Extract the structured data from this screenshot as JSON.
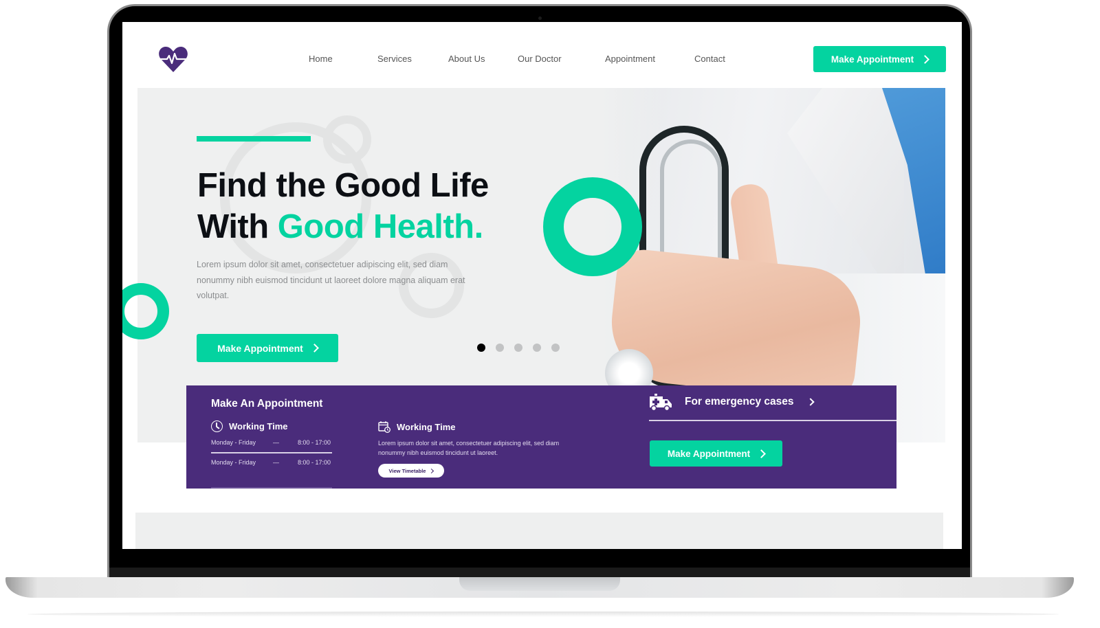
{
  "header": {
    "logo_icon": "heart-pulse-icon",
    "nav": [
      "Home",
      "Services",
      "About Us",
      "Our Doctor",
      "Appointment",
      "Contact"
    ],
    "cta_label": "Make Appointment"
  },
  "hero": {
    "title_line1": "Find the Good Life",
    "title_line2_prefix": "With ",
    "title_line2_highlight": "Good Health.",
    "description": "Lorem ipsum dolor sit amet, consectetuer adipiscing elit, sed diam nonummy nibh euismod tincidunt ut laoreet dolore magna aliquam erat volutpat.",
    "cta_label": "Make Appointment",
    "slides_total": 5,
    "slide_active": 1
  },
  "appointment_panel": {
    "title": "Make An Appointment",
    "working_time_1": {
      "icon": "clock-icon",
      "heading": "Working Time",
      "rows": [
        {
          "days": "Monday - Friday",
          "dash": "—",
          "hours": "8:00 - 17:00"
        },
        {
          "days": "Monday - Friday",
          "dash": "—",
          "hours": "8:00 - 17:00"
        }
      ]
    },
    "working_time_2": {
      "icon": "calendar-clock-icon",
      "heading": "Working Time",
      "description": "Lorem ipsum dolor sit amet, consectetuer adipiscing elit, sed diam nonummy nibh euismod tincidunt ut laoreet.",
      "button_label": "View Timetable"
    },
    "emergency": {
      "icon": "ambulance-icon",
      "label": "For emergency cases",
      "button_label": "Make Appointment"
    }
  },
  "colors": {
    "accent": "#04d3a0",
    "brand_purple": "#4a2c7b",
    "text_dark": "#0c0f14"
  }
}
